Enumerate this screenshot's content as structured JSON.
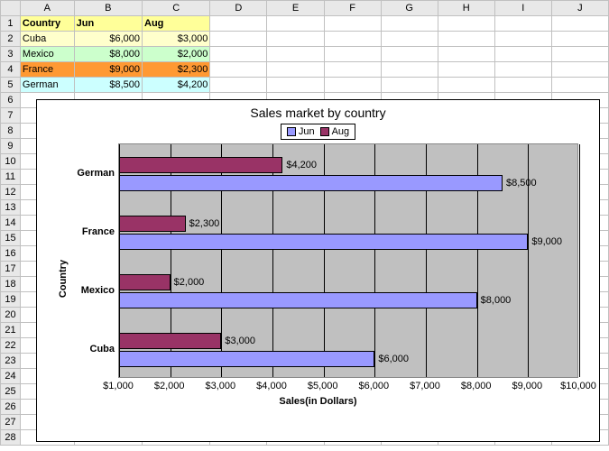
{
  "columns": [
    "A",
    "B",
    "C",
    "D",
    "E",
    "F",
    "G",
    "H",
    "I",
    "J"
  ],
  "rows": 28,
  "table": {
    "headers": {
      "country": "Country",
      "jun": "Jun",
      "aug": "Aug"
    },
    "data": [
      {
        "country": "Cuba",
        "jun": "$6,000",
        "aug": "$3,000",
        "cls": "rowCuba"
      },
      {
        "country": "Mexico",
        "jun": "$8,000",
        "aug": "$2,000",
        "cls": "rowMex"
      },
      {
        "country": "France",
        "jun": "$9,000",
        "aug": "$2,300",
        "cls": "rowFra"
      },
      {
        "country": "German",
        "jun": "$8,500",
        "aug": "$4,200",
        "cls": "rowGer"
      }
    ]
  },
  "chart_data": {
    "type": "bar",
    "orientation": "horizontal",
    "title": "Sales market by country",
    "xlabel": "Sales(in Dollars)",
    "ylabel": "Country",
    "xlim": [
      1000,
      10000
    ],
    "xticks": [
      1000,
      2000,
      3000,
      4000,
      5000,
      6000,
      7000,
      8000,
      9000,
      10000
    ],
    "xtick_labels": [
      "$1,000",
      "$2,000",
      "$3,000",
      "$4,000",
      "$5,000",
      "$6,000",
      "$7,000",
      "$8,000",
      "$9,000",
      "$10,000"
    ],
    "categories": [
      "German",
      "France",
      "Mexico",
      "Cuba"
    ],
    "series": [
      {
        "name": "Jun",
        "color": "#9999ff",
        "values": [
          8500,
          9000,
          8000,
          6000
        ],
        "labels": [
          "$8,500",
          "$9,000",
          "$8,000",
          "$6,000"
        ]
      },
      {
        "name": "Aug",
        "color": "#993366",
        "values": [
          4200,
          2300,
          2000,
          3000
        ],
        "labels": [
          "$4,200",
          "$2,300",
          "$2,000",
          "$3,000"
        ]
      }
    ],
    "legend": [
      "Jun",
      "Aug"
    ]
  }
}
